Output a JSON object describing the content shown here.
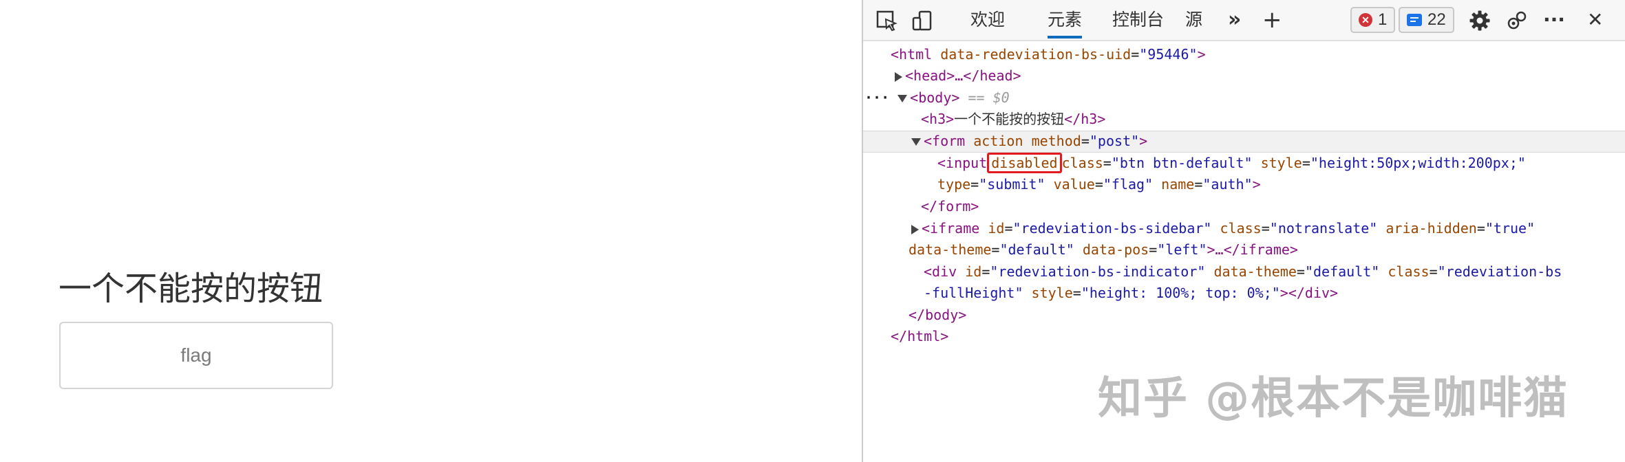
{
  "page": {
    "heading": "一个不能按的按钮",
    "button_label": "flag"
  },
  "devtools": {
    "tabs": {
      "welcome": "欢迎",
      "elements": "元素",
      "console": "控制台",
      "sources": "源"
    },
    "more_tabs": "»",
    "add_tab": "+",
    "error_count": "1",
    "message_count": "22",
    "more_menu": "···",
    "close": "✕"
  },
  "tree": {
    "l1_open": "<html",
    "l1_attr": "data-redeviation-bs-uid",
    "l1_val": "\"95446\"",
    "l1_close": ">",
    "l2": "<head>…</head>",
    "l3_dots": "···",
    "l3_tag": "<body>",
    "l3_eq": "== $0",
    "l4_open": "<h3>",
    "l4_text": "一个不能按的按钮",
    "l4_close": "</h3>",
    "l5_open": "<form",
    "l5_attr1": "action",
    "l5_attr2": "method",
    "l5_val2": "\"post\"",
    "l5_close": ">",
    "l6_open": "<input",
    "l6_disabled": "disabled",
    "l6_attr_class": "class",
    "l6_val_class": "\"btn btn-default\"",
    "l6_attr_style": "style",
    "l6_val_style": "\"height:50px;width:200px;\"",
    "l7_attr_type": "type",
    "l7_val_type": "\"submit\"",
    "l7_attr_value": "value",
    "l7_val_value": "\"flag\"",
    "l7_attr_name": "name",
    "l7_val_name": "\"auth\"",
    "l7_close": ">",
    "l8": "</form>",
    "l9_open": "<iframe",
    "l9_attr_id": "id",
    "l9_val_id": "\"redeviation-bs-sidebar\"",
    "l9_attr_class": "class",
    "l9_val_class": "\"notranslate\"",
    "l9_attr_aria": "aria-hidden",
    "l9_val_aria": "\"true\"",
    "l10_attr_theme": "data-theme",
    "l10_val_theme": "\"default\"",
    "l10_attr_pos": "data-pos",
    "l10_val_pos": "\"left\"",
    "l10_close": ">…</iframe>",
    "l11_open": "<div",
    "l11_attr_id": "id",
    "l11_val_id": "\"redeviation-bs-indicator\"",
    "l11_attr_theme": "data-theme",
    "l11_val_theme": "\"default\"",
    "l11_attr_class": "class",
    "l11_val_class": "\"redeviation-bs",
    "l12_val_class_cont": "-fullHeight\"",
    "l12_attr_style": "style",
    "l12_val_style": "\"height: 100%; top: 0%;\"",
    "l12_close": "></div>",
    "l13": "</body>",
    "l14": "</html>"
  },
  "watermark": "知乎 @根本不是咖啡猫",
  "colors": {
    "highlight_box": "#e3191f",
    "active_tab": "#0f6cbd",
    "tag": "#881280",
    "attr_name": "#994500",
    "attr_value": "#1a1aa6"
  }
}
